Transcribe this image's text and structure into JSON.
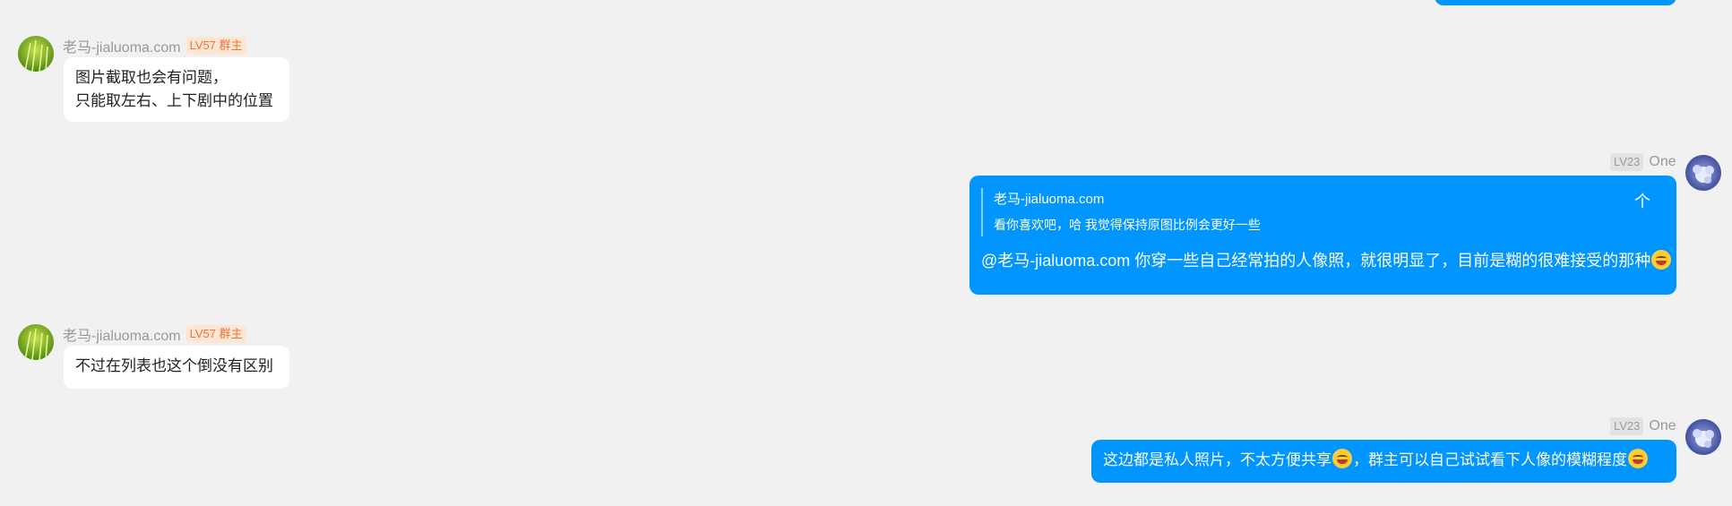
{
  "messages": [
    {
      "name": "老马-jialuoma.com",
      "badge": "LV57 群主",
      "lines": [
        "图片截取也会有问题，",
        "只能取左右、上下剧中的位置"
      ]
    },
    {
      "level": "LV23",
      "name": "One",
      "quote": {
        "name": "老马-jialuoma.com",
        "text": "看你喜欢吧，哈 我觉得保持原图比例会更好一些",
        "arrow": "个"
      },
      "text": "@老马-jialuoma.com 你穿一些自己经常拍的人像照，就很明显了，目前是糊的很难接受的那种",
      "emoji_end": "tongue-face-emoji"
    },
    {
      "name": "老马-jialuoma.com",
      "badge": "LV57 群主",
      "text": "不过在列表也这个倒没有区别"
    },
    {
      "level": "LV23",
      "name": "One",
      "text_part1": "这边都是私人照片，不太方便共享",
      "emoji_mid": "laughing-face-emoji",
      "text_part2": "，群主可以自己试试看下人像的模糊程度",
      "emoji_end": "tongue-face-emoji"
    }
  ],
  "colors": {
    "outgoing": "#0095ff",
    "incoming": "#ffffff",
    "background": "#f1f1f1",
    "owner_badge": "#f2733a"
  }
}
